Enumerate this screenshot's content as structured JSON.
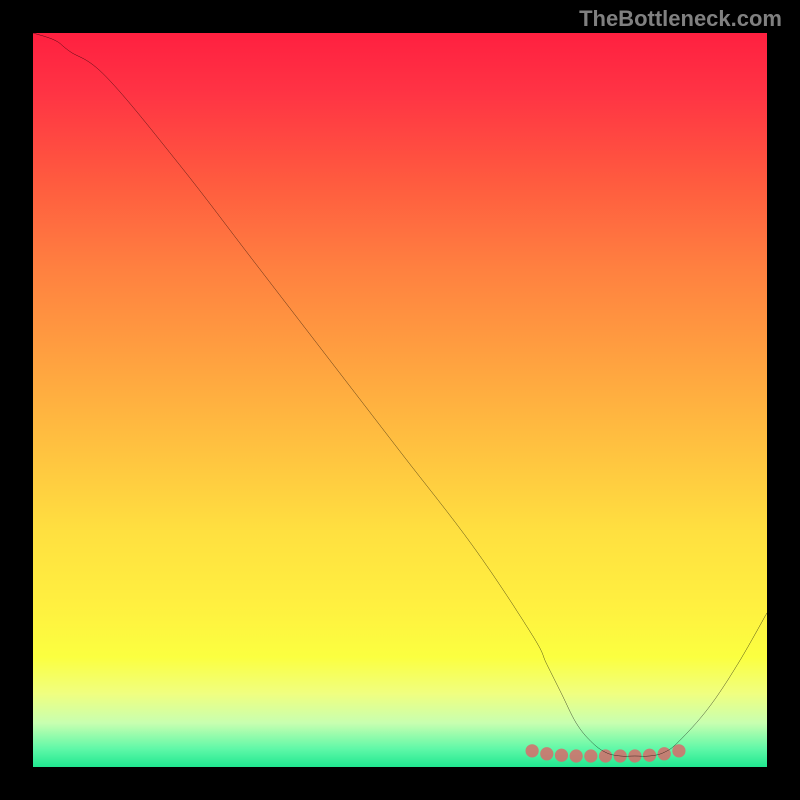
{
  "attribution": "TheBottleneck.com",
  "chart_data": {
    "type": "line",
    "title": "",
    "xlabel": "",
    "ylabel": "",
    "xlim": [
      0,
      100
    ],
    "ylim": [
      0,
      100
    ],
    "series": [
      {
        "name": "curve",
        "x": [
          0,
          3,
          5,
          10,
          20,
          30,
          40,
          50,
          60,
          68,
          70,
          72,
          74,
          76,
          78,
          80,
          82,
          84,
          86,
          88,
          92,
          96,
          100
        ],
        "values": [
          100,
          99,
          97.5,
          94,
          82,
          69,
          56,
          43,
          30,
          18,
          14,
          10,
          6,
          3.5,
          2,
          1.5,
          1.5,
          1.5,
          2,
          3.5,
          8,
          14,
          21
        ]
      },
      {
        "name": "markers",
        "x": [
          68,
          70,
          72,
          74,
          76,
          78,
          80,
          82,
          84,
          86,
          88
        ],
        "values": [
          2.2,
          1.8,
          1.6,
          1.5,
          1.5,
          1.5,
          1.5,
          1.5,
          1.6,
          1.8,
          2.2
        ]
      }
    ]
  }
}
